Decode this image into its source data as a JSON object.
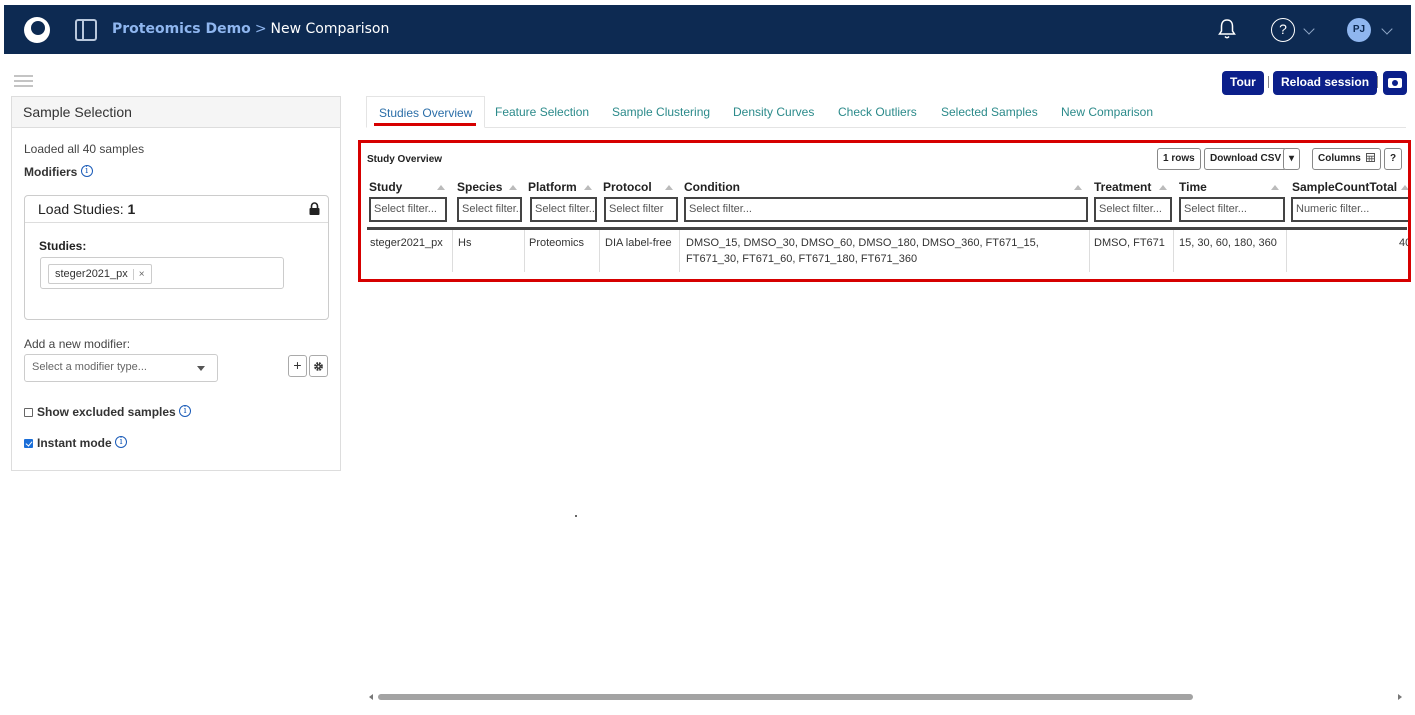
{
  "header": {
    "app_name": "Proteomics Demo",
    "separator": ">",
    "page_name": "New Comparison",
    "help_symbol": "?",
    "avatar_initials": "PJ",
    "bg_color": "#0d2a52"
  },
  "sidebar": {
    "title": "Sample Selection",
    "loaded_text": "Loaded all 40 samples",
    "modifiers_label": "Modifiers",
    "info_symbol": "i",
    "load_studies_label": "Load Studies:",
    "load_studies_count": "1",
    "studies_label": "Studies:",
    "study_tag": "steger2021_px",
    "tag_remove": "×",
    "add_modifier_label": "Add a new modifier:",
    "modifier_placeholder": "Select a modifier type...",
    "add_symbol": "+",
    "show_excluded_label": "Show excluded samples",
    "instant_mode_label": "Instant mode"
  },
  "toolbar": {
    "tour_label": "Tour",
    "reload_label": "Reload session"
  },
  "tabs": [
    {
      "label": "Studies Overview",
      "active": true
    },
    {
      "label": "Feature Selection"
    },
    {
      "label": "Sample Clustering"
    },
    {
      "label": "Density Curves"
    },
    {
      "label": "Check Outliers"
    },
    {
      "label": "Selected Samples"
    },
    {
      "label": "New Comparison"
    }
  ],
  "table": {
    "title": "Study Overview",
    "rows_label": "1 rows",
    "download_label": "Download CSV",
    "dropdown_symbol": "▾",
    "columns_label": "Columns",
    "help_label": "?",
    "columns": [
      {
        "header": "Study",
        "filter": "Select filter..."
      },
      {
        "header": "Species",
        "filter": "Select filter..."
      },
      {
        "header": "Platform",
        "filter": "Select filter..."
      },
      {
        "header": "Protocol",
        "filter": "Select filter"
      },
      {
        "header": "Condition",
        "filter": "Select filter..."
      },
      {
        "header": "Treatment",
        "filter": "Select filter..."
      },
      {
        "header": "Time",
        "filter": "Select filter..."
      },
      {
        "header": "SampleCountTotal",
        "filter": "Numeric filter..."
      }
    ],
    "rows": [
      {
        "study": "steger2021_px",
        "species": "Hs",
        "platform": "Proteomics",
        "protocol": "DIA label-free",
        "condition_line1": "DMSO_15, DMSO_30, DMSO_60, DMSO_180, DMSO_360, FT671_15,",
        "condition_line2": "FT671_30, FT671_60, FT671_180, FT671_360",
        "treatment": "DMSO, FT671",
        "time": "15, 30, 60, 180, 360",
        "sample_count_total": "40"
      }
    ]
  }
}
